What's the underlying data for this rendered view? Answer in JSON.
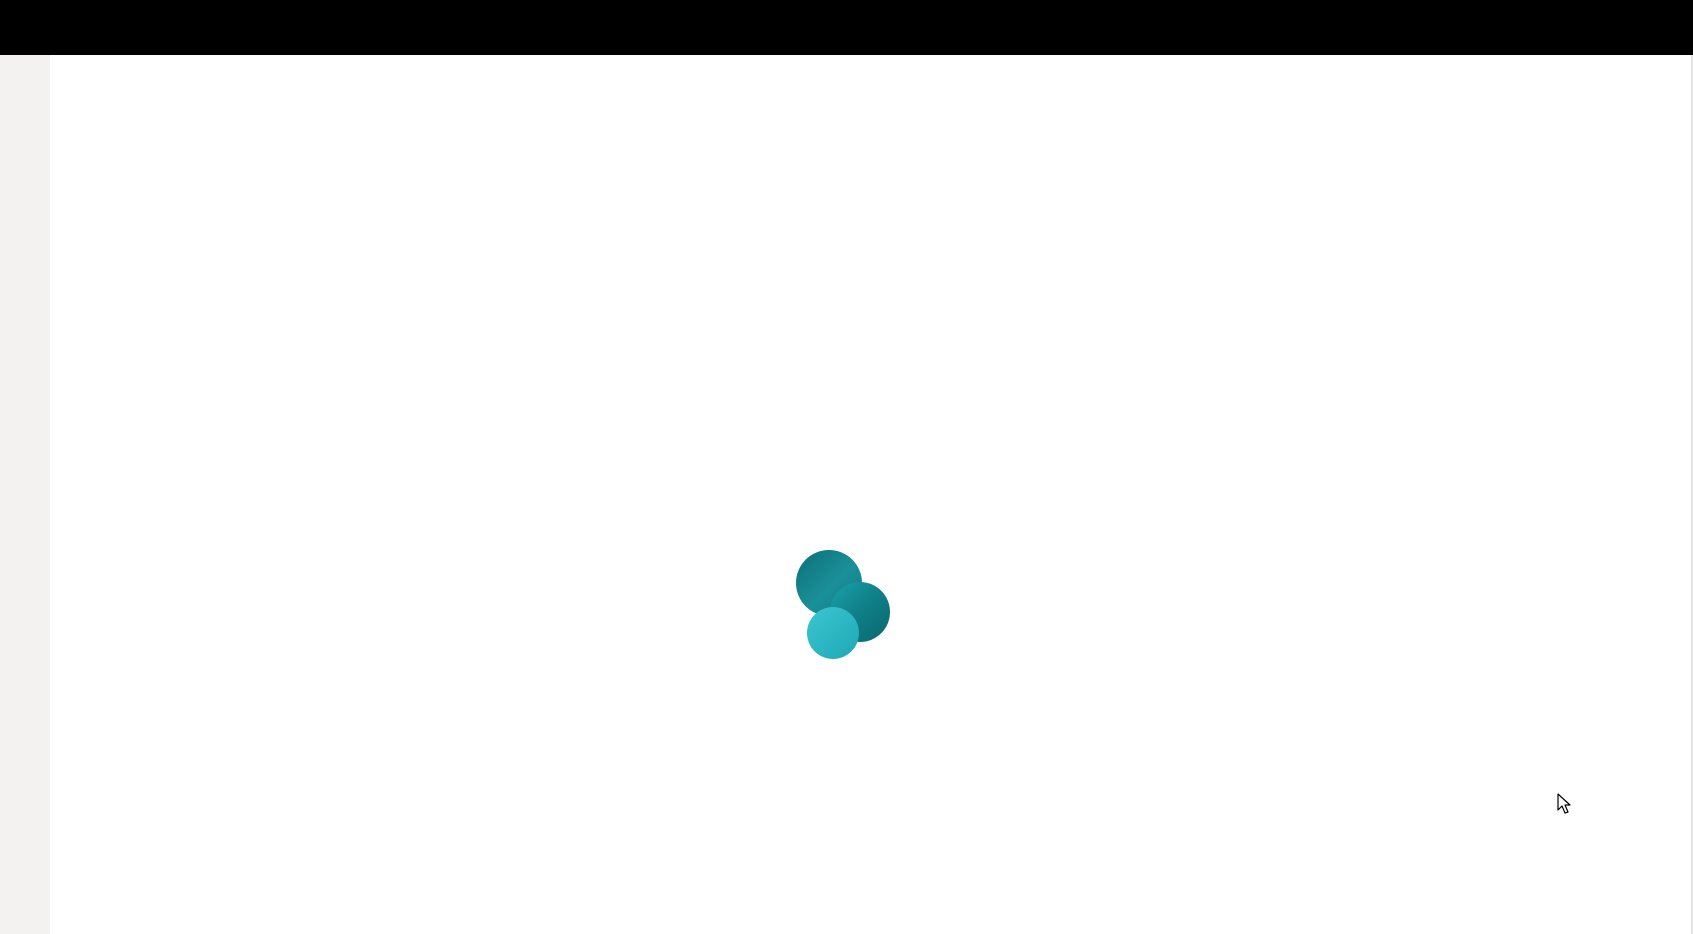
{
  "app": {
    "state": "loading",
    "logo_icon": "sharepoint-logo-icon",
    "brand_colors": {
      "primary_teal": "#0f7c84",
      "mid_teal": "#138a92",
      "light_teal": "#2fb8c6",
      "top_bar": "#000000",
      "left_rail": "#f3f2f1"
    }
  },
  "pointer": {
    "icon": "mouse-pointer-icon"
  }
}
